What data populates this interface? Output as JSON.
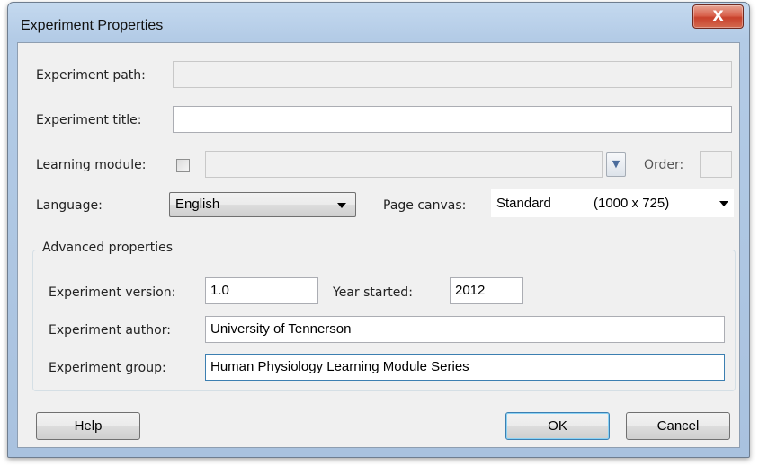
{
  "window": {
    "title": "Experiment Properties",
    "close_glyph": "X"
  },
  "form": {
    "path_label": "Experiment path:",
    "path_value": "",
    "title_label": "Experiment title:",
    "title_value": "",
    "learning_module_label": "Learning module:",
    "learning_module_checked": false,
    "learning_module_value": "",
    "order_label": "Order:",
    "order_value": "",
    "language_label": "Language:",
    "language_value": "English",
    "canvas_label": "Page canvas:",
    "canvas_name": "Standard",
    "canvas_size": "(1000 x 725)"
  },
  "advanced": {
    "legend": "Advanced properties",
    "version_label": "Experiment version:",
    "version_value": "1.0",
    "year_label": "Year started:",
    "year_value": "2012",
    "author_label": "Experiment author:",
    "author_value": "University of Tennerson",
    "group_label": "Experiment group:",
    "group_value": "Human Physiology Learning Module Series"
  },
  "buttons": {
    "help": "Help",
    "ok": "OK",
    "cancel": "Cancel"
  },
  "icons": {
    "close": "close-icon",
    "dropdown": "chevron-down-icon"
  },
  "colors": {
    "titlebar": "#b3cbe6",
    "close_button": "#c8412c",
    "focus_border": "#3c7fb1",
    "dialog_bg": "#f0f0f0"
  }
}
